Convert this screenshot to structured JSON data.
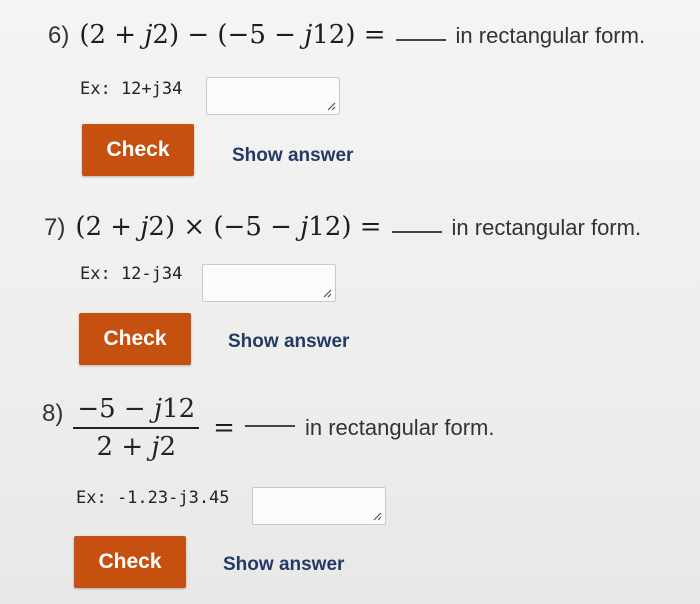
{
  "problems": [
    {
      "number": "6)",
      "expr_left": "(2 + ",
      "expr_j1": "j",
      "expr_mid": "2) − (−5 − ",
      "expr_j2": "j",
      "expr_right": "12) =",
      "suffix": "in rectangular form.",
      "example": "Ex: 12+j34",
      "input_value": "",
      "check_label": "Check",
      "show_answer_label": "Show answer"
    },
    {
      "number": "7)",
      "expr_left": "(2 + ",
      "expr_j1": "j",
      "expr_mid": "2) × (−5 − ",
      "expr_j2": "j",
      "expr_right": "12) =",
      "suffix": "in rectangular form.",
      "example": "Ex: 12-j34",
      "input_value": "",
      "check_label": "Check",
      "show_answer_label": "Show answer"
    },
    {
      "number": "8)",
      "numerator_left": "−5 − ",
      "numerator_j": "j",
      "numerator_right": "12",
      "denominator_left": "2 + ",
      "denominator_j": "j",
      "denominator_right": "2",
      "equals": "=",
      "suffix": "in rectangular form.",
      "example": "Ex: -1.23-j3.45",
      "input_value": "",
      "check_label": "Check",
      "show_answer_label": "Show answer"
    }
  ],
  "colors": {
    "check_button": "#c5500f",
    "show_answer_link": "#233a66",
    "background": "#f0f0ee"
  },
  "icons": {
    "input_resize": "resize-handle-icon"
  }
}
